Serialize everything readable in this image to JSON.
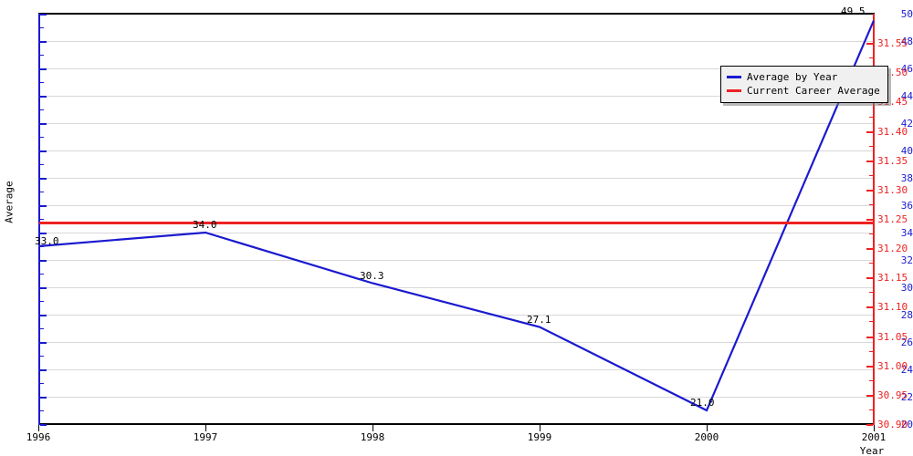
{
  "chart_data": {
    "type": "line",
    "title": "",
    "xlabel": "Year",
    "ylabel": "Average",
    "x": [
      1996,
      1997,
      1998,
      1999,
      2000,
      2001
    ],
    "xlim": [
      1996,
      2001
    ],
    "ylim": [
      20,
      50
    ],
    "y_right_lim": [
      30.9,
      31.6
    ],
    "grid": true,
    "legend_position": "top-right",
    "series": [
      {
        "name": "Average by Year",
        "color": "#1a1ad0",
        "axis": "left",
        "values": [
          33.0,
          34.0,
          30.3,
          27.1,
          21.0,
          49.5
        ],
        "point_labels": [
          "33.0",
          "34.0",
          "30.3",
          "27.1",
          "21.0",
          "49.5"
        ]
      },
      {
        "name": "Current Career Average",
        "color": "#ee2222",
        "axis": "left",
        "constant_value": 34.7,
        "right_axis_value": 31.25
      }
    ],
    "x_tick_labels": [
      "1996",
      "1997",
      "1998",
      "1999",
      "2000",
      "2001"
    ],
    "y_left_tick_labels": [
      "50",
      "48",
      "46",
      "44",
      "42",
      "40",
      "38",
      "36",
      "34",
      "32",
      "30",
      "28",
      "26",
      "24",
      "22",
      "20"
    ],
    "y_left_tick_values": [
      50,
      48,
      46,
      44,
      42,
      40,
      38,
      36,
      34,
      32,
      30,
      28,
      26,
      24,
      22,
      20
    ],
    "y_right_tick_labels": [
      "31.55",
      "31.50",
      "31.45",
      "31.40",
      "31.35",
      "31.30",
      "31.25",
      "31.20",
      "31.15",
      "31.10",
      "31.05",
      "31.00",
      "30.95",
      "30.90"
    ],
    "y_right_tick_values": [
      31.55,
      31.5,
      31.45,
      31.4,
      31.35,
      31.3,
      31.25,
      31.2,
      31.15,
      31.1,
      31.05,
      31.0,
      30.95,
      30.9
    ]
  },
  "legend": {
    "items": [
      {
        "label": "Average by Year",
        "color": "#1a1ad0"
      },
      {
        "label": "Current Career Average",
        "color": "#ee2222"
      }
    ]
  },
  "colors": {
    "series_blue": "#1a1ad0",
    "series_red": "#ee2222",
    "grid": "#d8d8d8",
    "axis_black": "#000000",
    "legend_bg": "#f0f0f0",
    "background": "#ffffff"
  }
}
